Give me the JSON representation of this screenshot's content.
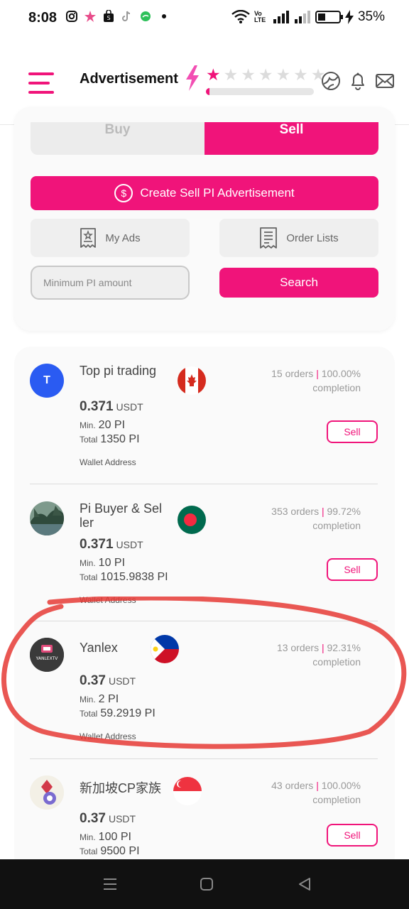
{
  "status_bar": {
    "time": "8:08",
    "battery_percent": "35%",
    "battery_level": 0.35,
    "network_label": "Vo LTE"
  },
  "header": {
    "title": "Advertisement",
    "rating_stars_filled": 1,
    "rating_stars_total": 7,
    "rating_progress": 0.03,
    "accent_color": "#f0147a"
  },
  "tabs": {
    "buy_label": "Buy",
    "sell_label": "Sell",
    "active": "Sell"
  },
  "actions": {
    "create_label": "Create Sell PI Advertisement",
    "my_ads_label": "My Ads",
    "order_lists_label": "Order Lists",
    "min_amount_placeholder": "Minimum PI amount",
    "search_label": "Search"
  },
  "listings": [
    {
      "name": "Top pi trading",
      "avatar_letter": "T",
      "flag": "canada",
      "orders": "15 orders",
      "completion_rate": "100.00%",
      "completion_label": "completion",
      "price": "0.371",
      "currency": "USDT",
      "min_label": "Min.",
      "min_value": "20 PI",
      "total_label": "Total",
      "total_value": "1350 PI",
      "wallet_label": "Wallet Address",
      "button_label": "Sell"
    },
    {
      "name": "Pi Buyer & Seller",
      "avatar_letter": "",
      "flag": "bangladesh",
      "orders": "353 orders",
      "completion_rate": "99.72%",
      "completion_label": "completion",
      "price": "0.371",
      "currency": "USDT",
      "min_label": "Min.",
      "min_value": "10 PI",
      "total_label": "Total",
      "total_value": "1015.9838 PI",
      "wallet_label": "Wallet Address",
      "button_label": "Sell"
    },
    {
      "name": "Yanlex",
      "avatar_letter": "YANLEXTV",
      "flag": "philippines",
      "orders": "13 orders",
      "completion_rate": "92.31%",
      "completion_label": "completion",
      "price": "0.37",
      "currency": "USDT",
      "min_label": "Min.",
      "min_value": "2 PI",
      "total_label": "Total",
      "total_value": "59.2919 PI",
      "wallet_label": "Wallet Address",
      "button_label": ""
    },
    {
      "name": "新加坡CP家族",
      "avatar_letter": "",
      "flag": "singapore",
      "orders": "43 orders",
      "completion_rate": "100.00%",
      "completion_label": "completion",
      "price": "0.37",
      "currency": "USDT",
      "min_label": "Min.",
      "min_value": "100 PI",
      "total_label": "Total",
      "total_value": "9500 PI",
      "wallet_label": "",
      "button_label": "Sell"
    }
  ]
}
